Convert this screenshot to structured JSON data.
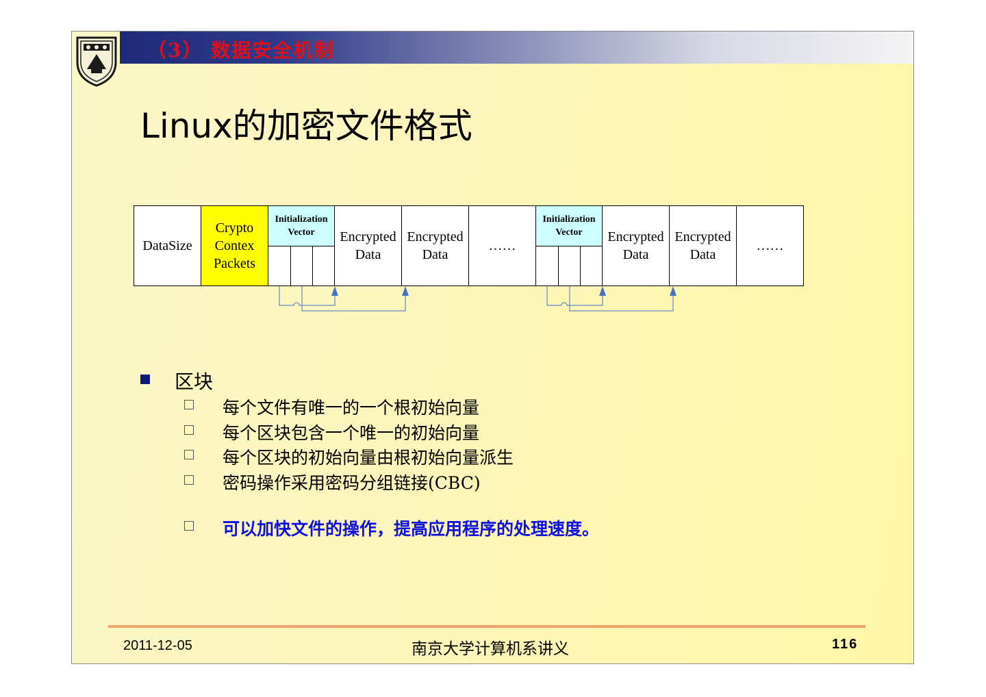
{
  "header": {
    "section_title": "（3） 数据安全机制"
  },
  "page_title": "Linux的加密文件格式",
  "diagram": {
    "datasize": "DataSize",
    "crypto_line1": "Crypto",
    "crypto_line2": "Contex",
    "crypto_line3": "Packets",
    "iv_line1": "Initialization",
    "iv_line2": "Vector",
    "encrypted_line1": "Encrypted",
    "encrypted_line2": "Data",
    "ellipsis": "……",
    "highlight_color": "#ffff00",
    "iv_color": "#ccffff",
    "arrow_color": "#4472c4"
  },
  "bullets": {
    "main": "区块",
    "items": [
      "每个文件有唯一的一个根初始向量",
      "每个区块包含一个唯一的初始向量",
      "每个区块的初始向量由根初始向量派生",
      "密码操作采用密码分组链接(CBC)",
      "可以加快文件的操作，提高应用程序的处理速度。"
    ]
  },
  "footer": {
    "date": "2011-12-05",
    "center": "南京大学计算机系讲义",
    "page": "116"
  }
}
